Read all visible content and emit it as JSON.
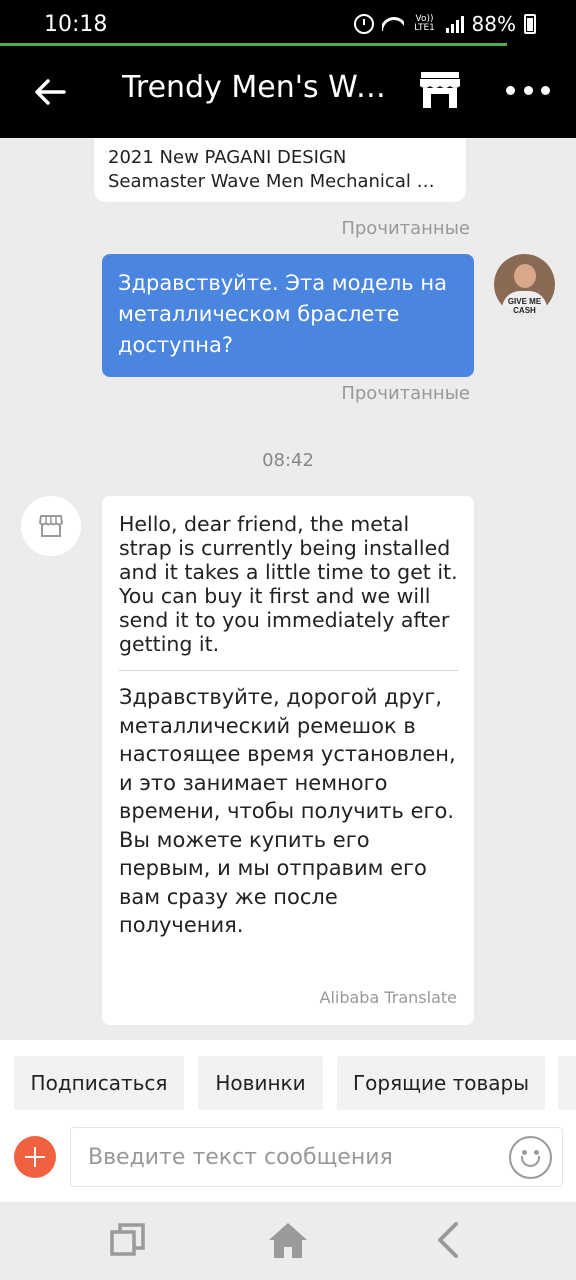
{
  "status_bar": {
    "time": "10:18",
    "volte": "Vo)) LTE1",
    "battery": "88%",
    "progress": 0.88
  },
  "header": {
    "title": "Trendy Men's Watches Store",
    "icons": {
      "back": "back-arrow-icon",
      "store": "store-icon",
      "more": "more-options-icon"
    }
  },
  "chat": {
    "product_card": {
      "line1": "2021 New PAGANI DESIGN",
      "line2": "Seamaster Wave Men Mechanical Watch"
    },
    "read_label_1": "Прочитанные",
    "outgoing_message": "Здравствуйте. Эта модель на металлическом браслете доступна?",
    "avatar_text": "GIVE ME CASH",
    "read_label_2": "Прочитанные",
    "timestamp": "08:42",
    "incoming_message": {
      "original": "Hello, dear friend, the metal strap is currently being installed and it takes a little time to get it. You can buy it first and we will send it to you immediately after getting it.",
      "translated": "Здравствуйте, дорогой друг, металлический ремешок в настоящее время установлен, и это занимает немного времени, чтобы получить его. Вы можете купить его первым, и мы отправим его вам сразу же после получения.",
      "translation_credit": "Alibaba Translate"
    }
  },
  "quick_replies": [
    "Подписаться",
    "Новинки",
    "Горящие товары"
  ],
  "composer": {
    "placeholder": "Введите текст сообщения",
    "icons": {
      "add": "plus-icon",
      "emoji": "emoji-icon"
    }
  },
  "nav_bar": {
    "icons": [
      "recents-icon",
      "home-icon",
      "back-icon"
    ]
  },
  "colors": {
    "outgoing_bubble": "#4a86e0",
    "add_button": "#f2613f",
    "header_bg": "#000000",
    "status_progress": "#4caf50"
  }
}
